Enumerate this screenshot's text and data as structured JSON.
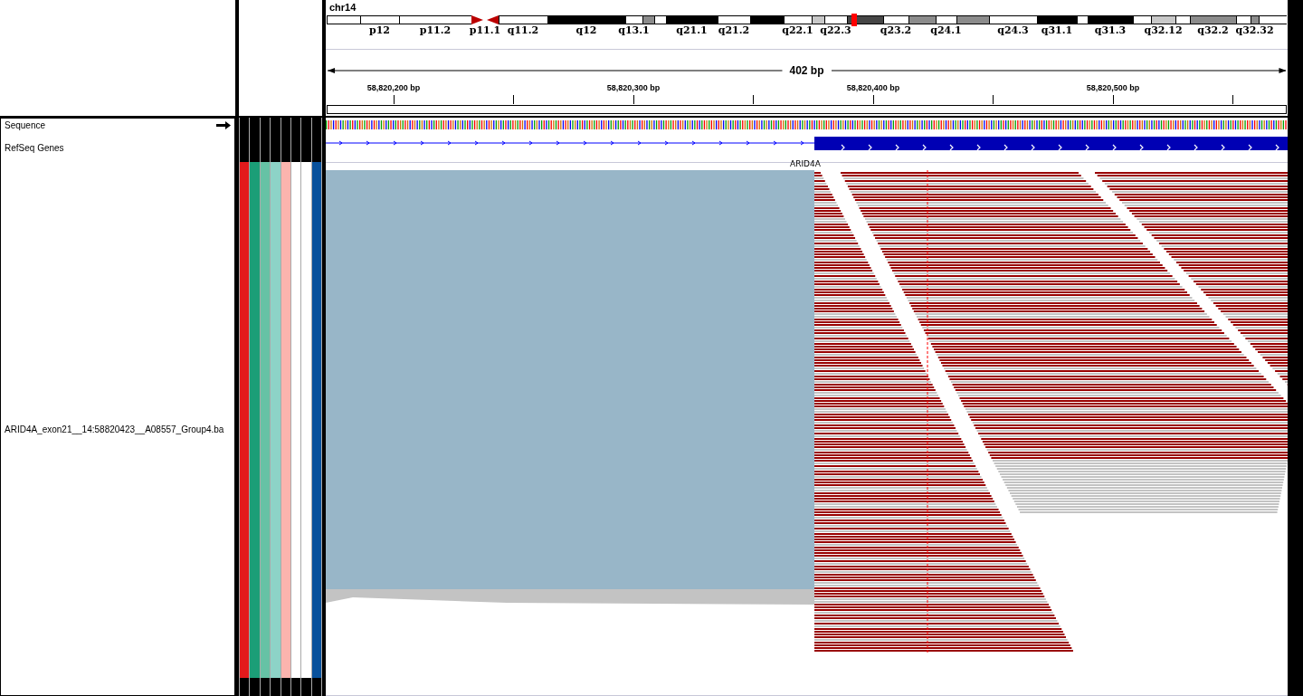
{
  "chromosome": {
    "name": "chr14",
    "bands": [
      {
        "kind": "gneg"
      },
      {
        "kind": "gneg",
        "label": "p12"
      },
      {
        "kind": "gneg",
        "label": "p11.2"
      },
      {
        "kind": "acen",
        "label": "p11.1"
      },
      {
        "kind": "gneg",
        "label": "q11.2"
      },
      {
        "kind": "gpos100",
        "label": "q12"
      },
      {
        "kind": "gneg",
        "label": "q13.1"
      },
      {
        "kind": "gpos50"
      },
      {
        "kind": "gneg"
      },
      {
        "kind": "gpos100",
        "label": "q21.1"
      },
      {
        "kind": "gneg",
        "label": "q21.2"
      },
      {
        "kind": "gpos100"
      },
      {
        "kind": "gneg",
        "label": "q22.1"
      },
      {
        "kind": "gpos25"
      },
      {
        "kind": "gneg",
        "label": "q22.3"
      },
      {
        "kind": "gpos75"
      },
      {
        "kind": "gneg",
        "label": "q23.2"
      },
      {
        "kind": "gpos50"
      },
      {
        "kind": "gneg",
        "label": "q24.1"
      },
      {
        "kind": "gpos50"
      },
      {
        "kind": "gneg",
        "label": "q24.3"
      },
      {
        "kind": "gpos100",
        "label": "q31.1"
      },
      {
        "kind": "gneg"
      },
      {
        "kind": "gpos100",
        "label": "q31.3"
      },
      {
        "kind": "gneg"
      },
      {
        "kind": "gpos25",
        "label": "q32.12"
      },
      {
        "kind": "gneg"
      },
      {
        "kind": "gpos50",
        "label": "q32.2"
      },
      {
        "kind": "gneg"
      },
      {
        "kind": "gpos50",
        "label": "q32.32"
      },
      {
        "kind": "gneg"
      }
    ]
  },
  "ruler": {
    "span": "402 bp",
    "ticks": [
      "58,820,200 bp",
      "58,820,300 bp",
      "58,820,400 bp",
      "58,820,500 bp"
    ]
  },
  "tracks": [
    {
      "kind": "sequence",
      "name": "Sequence"
    },
    {
      "kind": "genes",
      "name": "RefSeq Genes",
      "gene": "ARID4A"
    },
    {
      "kind": "alignment",
      "name": "ARID4A_exon21__14:58820423__A08557_Group4.ba"
    }
  ],
  "attributes": [
    {
      "color": "#e31a1c"
    },
    {
      "color": "#1b9e77"
    },
    {
      "color": "#66c2a5"
    },
    {
      "color": "#8dd3c7"
    },
    {
      "color": "#fbb4ae"
    },
    {
      "color": "#ffffff"
    },
    {
      "color": "#ffffff"
    },
    {
      "color": "#08519c"
    }
  ]
}
